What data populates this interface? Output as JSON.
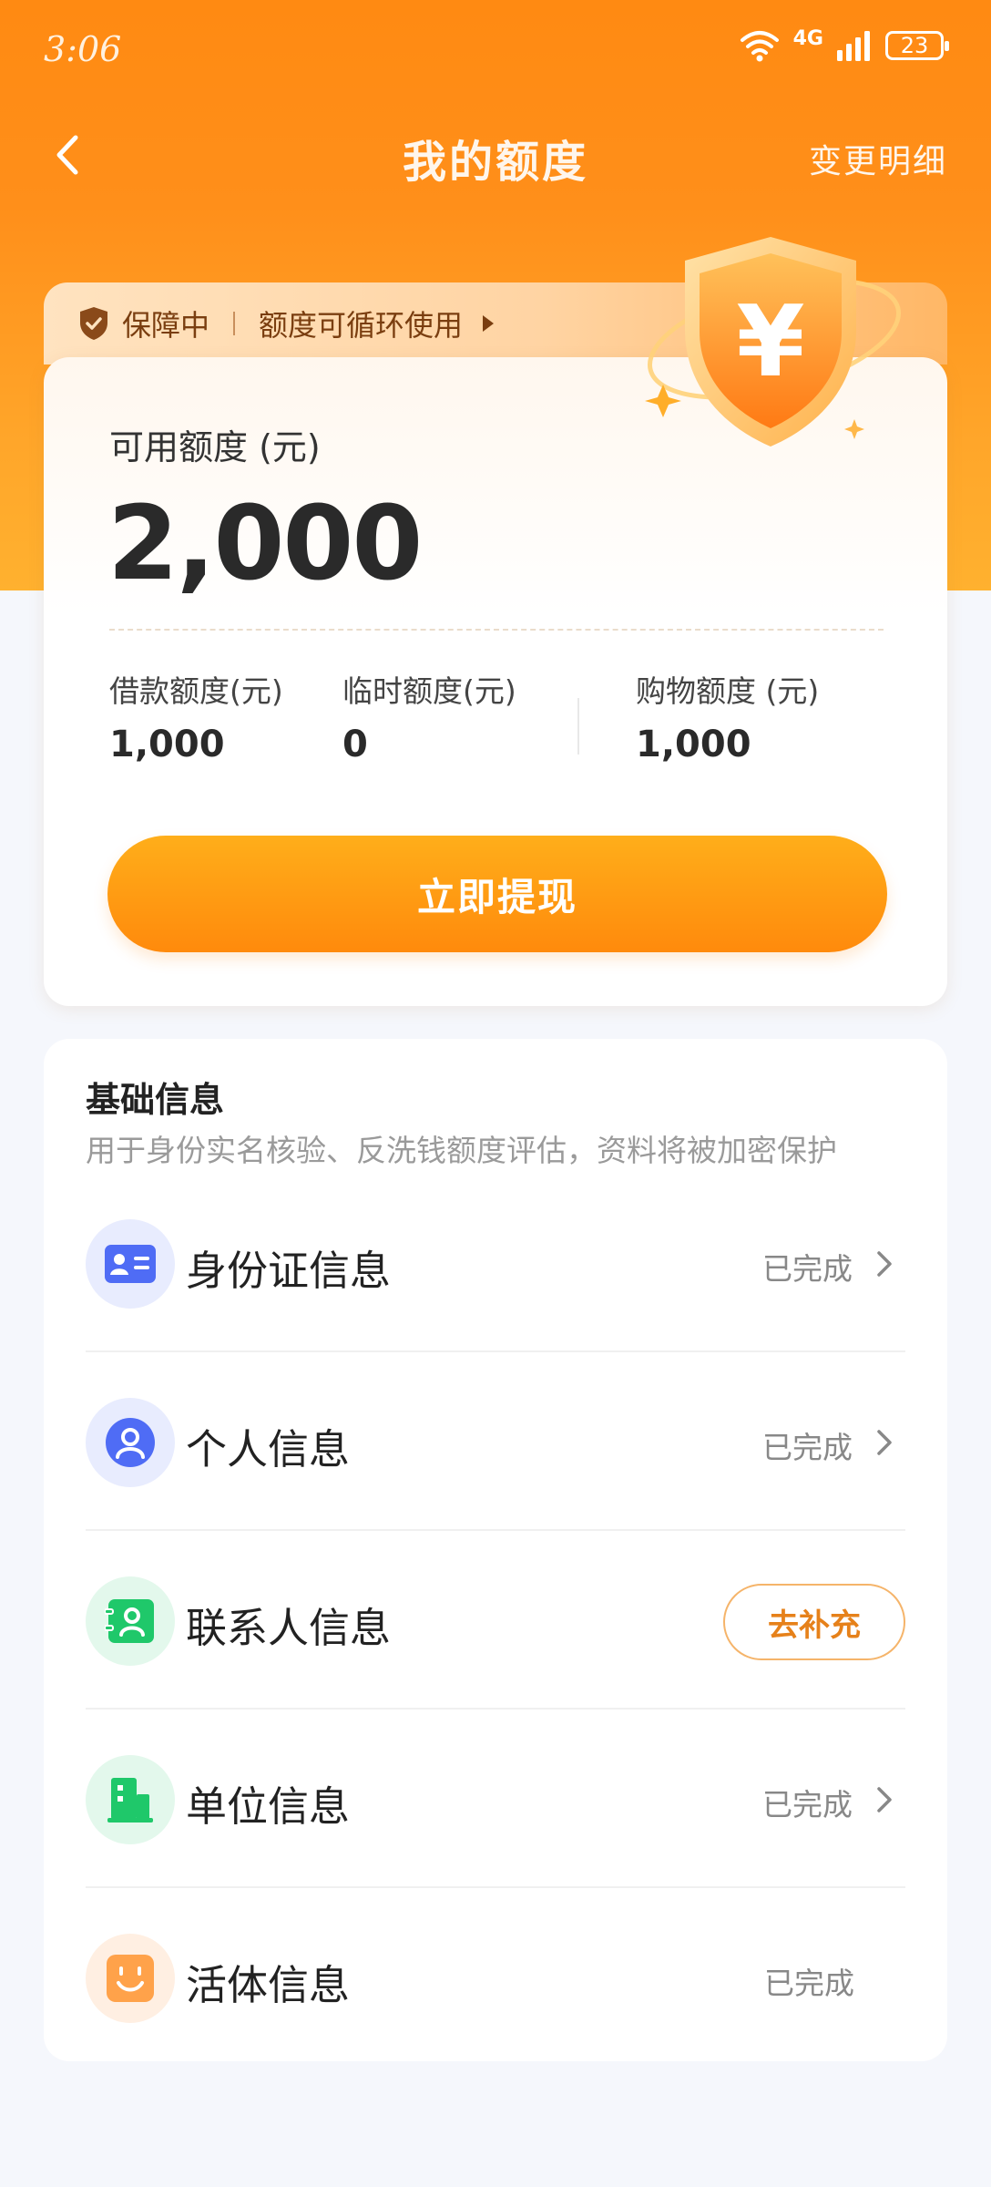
{
  "status_bar": {
    "time": "3:06",
    "network": "4G",
    "battery": "23"
  },
  "nav": {
    "title": "我的额度",
    "right_link": "变更明细"
  },
  "banner": {
    "status": "保障中",
    "text": "额度可循环使用"
  },
  "credit": {
    "available_label": "可用额度 (元)",
    "available_amount": "2,000",
    "sub_items": [
      {
        "label": "借款额度(元)",
        "value": "1,000"
      },
      {
        "label": "临时额度(元)",
        "value": "0"
      },
      {
        "label": "购物额度 (元)",
        "value": "1,000"
      }
    ],
    "withdraw_label": "立即提现",
    "shield_symbol": "¥"
  },
  "basic_info": {
    "title": "基础信息",
    "description": "用于身份实名核验、反洗钱额度评估，资料将被加密保护",
    "items": [
      {
        "label": "身份证信息",
        "status": "已完成",
        "icon": "id-card-icon"
      },
      {
        "label": "个人信息",
        "status": "已完成",
        "icon": "person-icon"
      },
      {
        "label": "联系人信息",
        "action": "去补充",
        "icon": "contacts-icon"
      },
      {
        "label": "单位信息",
        "status": "已完成",
        "icon": "building-icon"
      },
      {
        "label": "活体信息",
        "status": "已完成",
        "icon": "face-icon"
      }
    ]
  },
  "colors": {
    "primary": "#FF8A12",
    "accent_orange": "#E6811A",
    "blue": "#4F6CF5",
    "green": "#1FC86A",
    "face_orange": "#FFA24A"
  }
}
